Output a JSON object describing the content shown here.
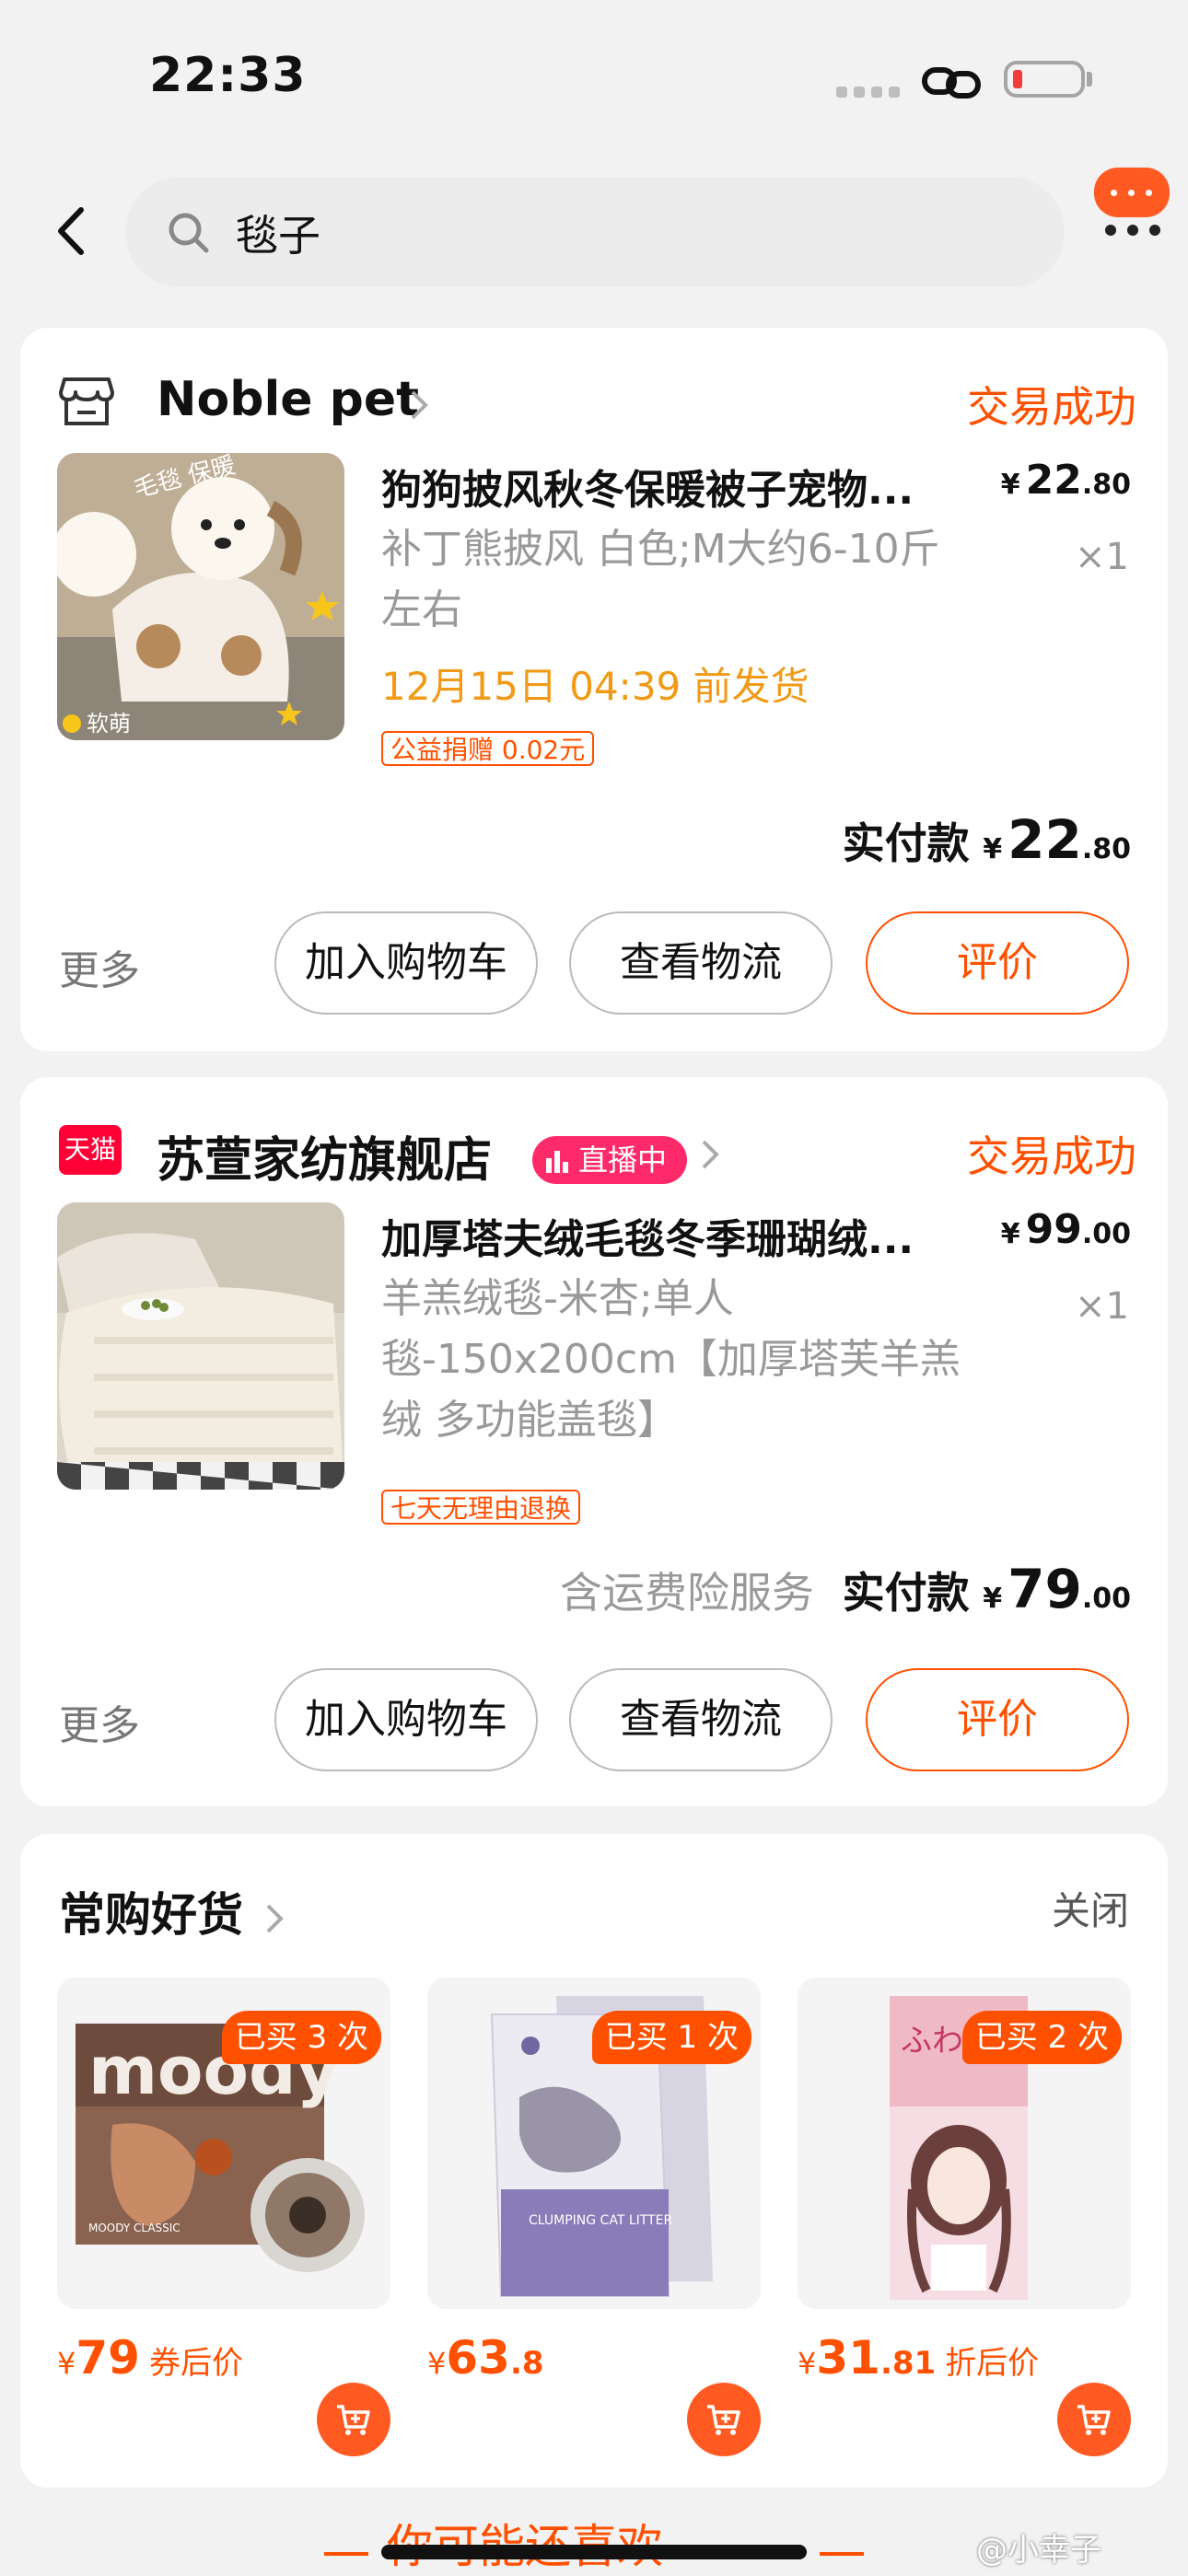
{
  "status_bar": {
    "time": "22:33",
    "battery_level": 0.1
  },
  "search": {
    "query": "毯子"
  },
  "orders": [
    {
      "shop": "Noble pet",
      "status": "交易成功",
      "title": "狗狗披风秋冬保暖被子宠物...",
      "price_int": "22",
      "price_dec": ".80",
      "qty": "×1",
      "spec": "补丁熊披风 白色;M大约6-10斤左右",
      "ship_time": "12月15日 04:39 前发货",
      "tag": "公益捐赠 0.02元",
      "thumb_text_1": "毛毯 保暖",
      "thumb_text_2": "软萌",
      "pay_label": "实付款",
      "pay_int": "22",
      "pay_dec": ".80",
      "more": "更多",
      "btn_cart": "加入购物车",
      "btn_logistics": "查看物流",
      "btn_review": "评价"
    },
    {
      "shop": "苏萱家纺旗舰店",
      "shop_badge": "天猫",
      "live": "直播中",
      "status": "交易成功",
      "title": "加厚塔夫绒毛毯冬季珊瑚绒...",
      "price_int": "99",
      "price_dec": ".00",
      "qty": "×1",
      "spec": "羊羔绒毯-米杏;单人毯-150x200cm【加厚塔芙羊羔绒 多功能盖毯】",
      "tag": "七天无理由退换",
      "pay_note": "含运费险服务",
      "pay_label": "实付款",
      "pay_int": "79",
      "pay_dec": ".00",
      "more": "更多",
      "btn_cart": "加入购物车",
      "btn_logistics": "查看物流",
      "btn_review": "评价"
    }
  ],
  "frequent": {
    "title": "常购好货",
    "close": "关闭",
    "items": [
      {
        "bought": "已买 3 次",
        "price_int": "79",
        "price_dec": "",
        "note": "券后价",
        "brand": "moody",
        "sub": "MOODY CLASSIC"
      },
      {
        "bought": "已买 1 次",
        "price_int": "63",
        "price_dec": ".8",
        "note": "",
        "sub": "CLUMPING CAT LITTER"
      },
      {
        "bought": "已买 2 次",
        "price_int": "31",
        "price_dec": ".81",
        "note": "折后价",
        "sub": "ふわ"
      }
    ]
  },
  "bottom": {
    "guess": "你可能还喜欢",
    "watermark": "@小幸子"
  },
  "colors": {
    "accent": "#ff5000",
    "ship": "#f09a16",
    "tmall": "#ff0036",
    "live": "#ff2a6a"
  }
}
